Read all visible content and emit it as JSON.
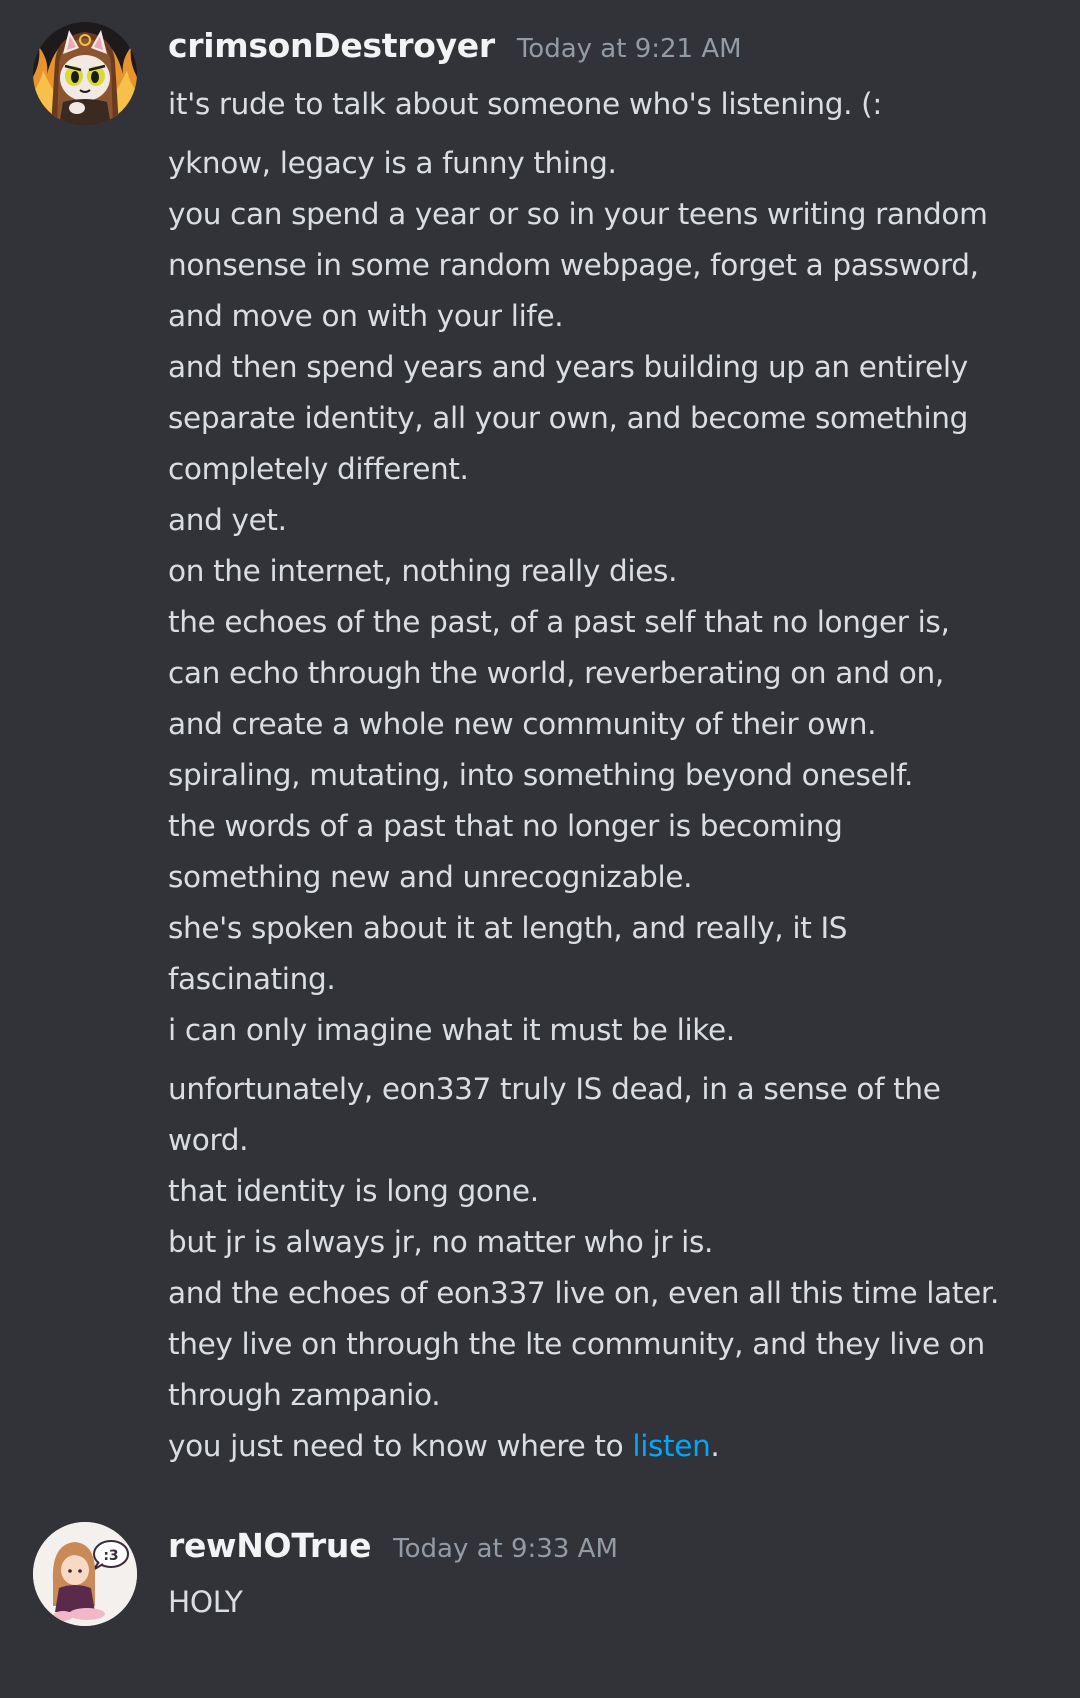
{
  "messages": [
    {
      "username": "crimsonDestroyer",
      "timestamp": "Today at 9:21 AM",
      "avatar_icon": "cat-hood-avatar-icon",
      "first_line": "it's rude to talk about someone who's listening. (:",
      "block2": [
        "yknow, legacy is a funny thing.",
        "you can spend a year or so in your teens writing random",
        "nonsense in some random webpage, forget a password,",
        "and move on with your life.",
        "and then spend years and years building up an entirely",
        "separate identity, all your own, and become something",
        "completely different.",
        "and yet.",
        "on the internet, nothing really dies.",
        "the echoes of the past, of a past self that no longer is,",
        "can echo through the world, reverberating on and on,",
        "and create a whole new community of their own.",
        "spiraling, mutating, into something beyond oneself.",
        "the words of a past that no longer is becoming",
        "something new and unrecognizable.",
        "she's spoken about it at length, and really, it IS",
        "fascinating.",
        "i can only imagine what it must be like."
      ],
      "block3": [
        "unfortunately, eon337 truly IS dead, in a sense of the",
        "word.",
        "that identity is long gone.",
        "but jr is always jr, no matter who jr is.",
        "and the echoes of eon337 live on, even all this time later.",
        "they live on through the lte community, and they live on",
        "through zampanio."
      ],
      "last_line_prefix": "you just need to know where to ",
      "last_line_link": "listen",
      "last_line_suffix": "."
    },
    {
      "username": "rewNOTrue",
      "timestamp": "Today at 9:33 AM",
      "avatar_icon": "girl-speech-bubble-avatar-icon",
      "avatar_bubble_text": ":3",
      "text": "HOLY"
    }
  ],
  "colors": {
    "background": "#313338",
    "username": "#f2f3f5",
    "timestamp": "#949ba4",
    "message_text": "#dbdee1",
    "link": "#00a8fc"
  }
}
